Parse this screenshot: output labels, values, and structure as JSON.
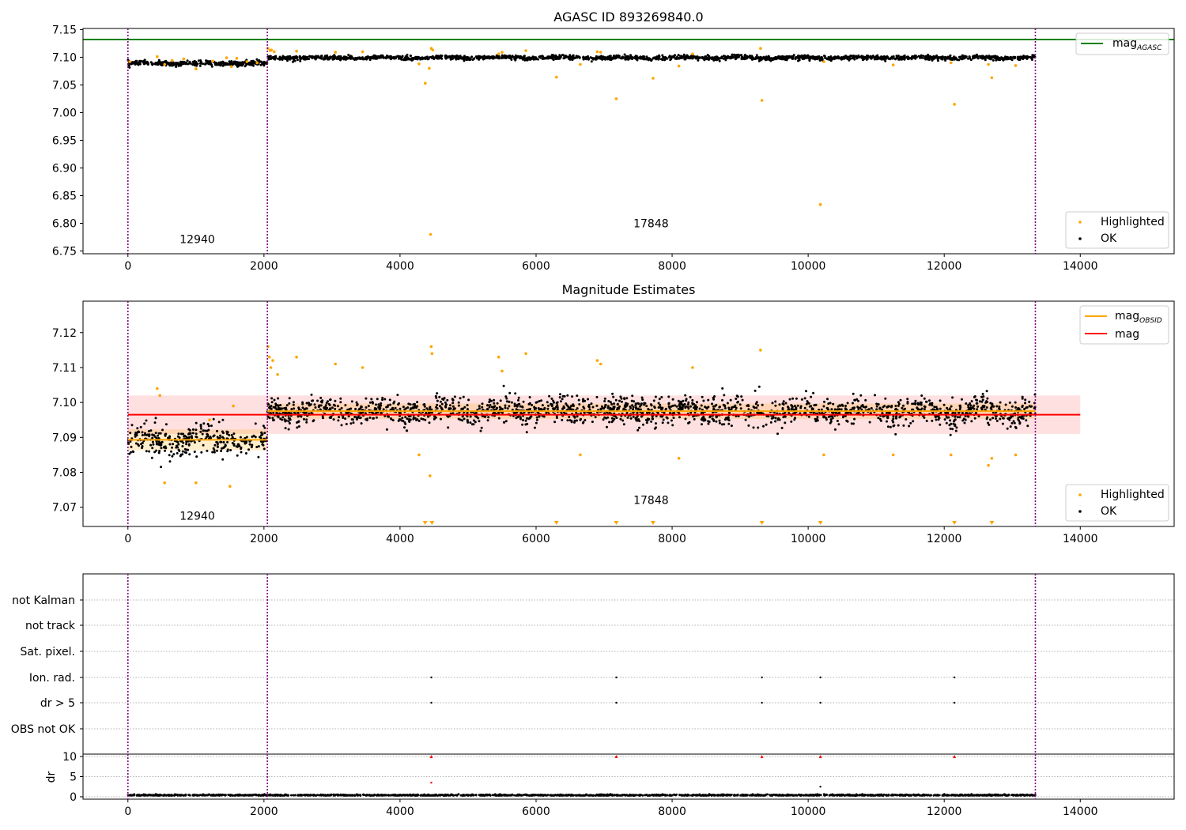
{
  "chart_data": [
    {
      "type": "scatter",
      "title": "AGASC ID 893269840.0",
      "xlim": [
        -660,
        15380
      ],
      "ylim": [
        6.745,
        7.152
      ],
      "yticks": [
        "6.75",
        "6.80",
        "6.85",
        "6.90",
        "6.95",
        "7.00",
        "7.05",
        "7.10",
        "7.15"
      ],
      "xticks": [
        "0",
        "2000",
        "4000",
        "6000",
        "8000",
        "10000",
        "12000",
        "14000"
      ],
      "obsid_labels": [
        {
          "text": "12940",
          "x": 1020,
          "y": 6.764
        },
        {
          "text": "17848",
          "x": 7690,
          "y": 6.793
        }
      ],
      "obsid_boundaries": [
        0,
        2050,
        13340
      ],
      "reference_lines": [
        {
          "name": "mag_AGASC",
          "y": 7.132,
          "color": "#008000"
        }
      ],
      "segments": [
        {
          "x0": 0,
          "x1": 2050,
          "mean": 7.089,
          "spread": 0.004
        },
        {
          "x0": 2050,
          "x1": 13340,
          "mean": 7.099,
          "spread": 0.0035
        }
      ],
      "highlighted": [
        [
          30,
          7.092
        ],
        [
          430,
          7.101
        ],
        [
          540,
          7.087
        ],
        [
          650,
          7.094
        ],
        [
          820,
          7.097
        ],
        [
          1000,
          7.079
        ],
        [
          1250,
          7.093
        ],
        [
          1450,
          7.099
        ],
        [
          1520,
          7.083
        ],
        [
          1600,
          7.098
        ],
        [
          1750,
          7.092
        ],
        [
          1900,
          7.09
        ],
        [
          2060,
          7.116
        ],
        [
          2090,
          7.112
        ],
        [
          2110,
          7.113
        ],
        [
          2150,
          7.11
        ],
        [
          2480,
          7.111
        ],
        [
          3050,
          7.109
        ],
        [
          3450,
          7.11
        ],
        [
          4280,
          7.088
        ],
        [
          4370,
          7.053
        ],
        [
          4430,
          7.08
        ],
        [
          4450,
          6.78
        ],
        [
          4460,
          7.116
        ],
        [
          4480,
          7.113
        ],
        [
          5450,
          7.106
        ],
        [
          5500,
          7.109
        ],
        [
          5850,
          7.112
        ],
        [
          6300,
          7.064
        ],
        [
          6650,
          7.087
        ],
        [
          6900,
          7.11
        ],
        [
          6950,
          7.109
        ],
        [
          7180,
          7.025
        ],
        [
          7720,
          7.062
        ],
        [
          8100,
          7.084
        ],
        [
          8300,
          7.106
        ],
        [
          9300,
          7.116
        ],
        [
          9320,
          7.022
        ],
        [
          10180,
          6.834
        ],
        [
          10230,
          7.092
        ],
        [
          11250,
          7.086
        ],
        [
          12100,
          7.09
        ],
        [
          12150,
          7.015
        ],
        [
          12650,
          7.087
        ],
        [
          12700,
          7.063
        ],
        [
          13050,
          7.085
        ]
      ],
      "legend": [
        {
          "label": "mag_AGASC",
          "position": "top-right"
        },
        {
          "label": "Highlighted"
        },
        {
          "label": "OK"
        }
      ],
      "legend_main": "mag",
      "legend_sub": "AGASC",
      "legend_points": [
        "Highlighted",
        "OK"
      ]
    },
    {
      "type": "scatter",
      "title": "Magnitude Estimates",
      "xlim": [
        -660,
        15380
      ],
      "ylim": [
        7.0645,
        7.129
      ],
      "yticks": [
        "7.07",
        "7.08",
        "7.09",
        "7.10",
        "7.11",
        "7.12"
      ],
      "xticks": [
        "0",
        "2000",
        "4000",
        "6000",
        "8000",
        "10000",
        "12000",
        "14000"
      ],
      "obsid_labels": [
        {
          "text": "12940",
          "x": 1020,
          "y": 7.0664
        },
        {
          "text": "17848",
          "x": 7690,
          "y": 7.071
        }
      ],
      "obsid_boundaries": [
        0,
        2050,
        13340
      ],
      "segments": [
        {
          "x0": 0,
          "x1": 2050,
          "mean": 7.0893,
          "spread": 0.004
        },
        {
          "x0": 2050,
          "x1": 13340,
          "mean": 7.0975,
          "spread": 0.0035
        }
      ],
      "mag_obsid": [
        {
          "x0": 0,
          "x1": 2050,
          "y": 7.0893,
          "lo": 7.0863,
          "hi": 7.0923
        },
        {
          "x0": 2050,
          "x1": 13340,
          "y": 7.0975,
          "lo": 7.0953,
          "hi": 7.0997
        }
      ],
      "mag": {
        "x0": 0,
        "x1": 14000,
        "y": 7.0965,
        "lo": 7.091,
        "hi": 7.102
      },
      "highlighted": [
        [
          430,
          7.104
        ],
        [
          470,
          7.102
        ],
        [
          540,
          7.077
        ],
        [
          1000,
          7.077
        ],
        [
          1200,
          7.095
        ],
        [
          1500,
          7.076
        ],
        [
          1550,
          7.099
        ],
        [
          2060,
          7.116
        ],
        [
          2080,
          7.113
        ],
        [
          2100,
          7.11
        ],
        [
          2130,
          7.112
        ],
        [
          2200,
          7.108
        ],
        [
          2480,
          7.113
        ],
        [
          3050,
          7.111
        ],
        [
          3450,
          7.11
        ],
        [
          4280,
          7.085
        ],
        [
          4440,
          7.079
        ],
        [
          4460,
          7.116
        ],
        [
          4470,
          7.114
        ],
        [
          5450,
          7.113
        ],
        [
          5500,
          7.109
        ],
        [
          5850,
          7.114
        ],
        [
          6650,
          7.085
        ],
        [
          6900,
          7.112
        ],
        [
          6950,
          7.111
        ],
        [
          8100,
          7.084
        ],
        [
          8300,
          7.11
        ],
        [
          9300,
          7.115
        ],
        [
          10230,
          7.085
        ],
        [
          11250,
          7.085
        ],
        [
          12100,
          7.085
        ],
        [
          12650,
          7.082
        ],
        [
          12700,
          7.084
        ],
        [
          13050,
          7.085
        ]
      ],
      "below_range": [
        4370,
        4470,
        6300,
        7180,
        7720,
        9320,
        10180,
        12150,
        12700
      ],
      "legend_main_obsid": "mag",
      "legend_sub_obsid": "OBSID",
      "legend_mag": "mag",
      "legend_points": [
        "Highlighted",
        "OK"
      ]
    },
    {
      "type": "scatter",
      "title": "",
      "xlim": [
        -660,
        15380
      ],
      "flag_categories": [
        "not Kalman",
        "not track",
        "Sat. pixel.",
        "Ion. rad.",
        "dr > 5",
        "OBS not OK"
      ],
      "flags": {
        "Ion. rad.": [
          4460,
          7180,
          9320,
          10180,
          12150
        ],
        "dr > 5": [
          4460,
          7180,
          9320,
          10180,
          12150
        ]
      },
      "obsid_boundaries": [
        0,
        2050,
        13340
      ]
    },
    {
      "type": "scatter",
      "title": "",
      "ylabel": "dr",
      "xlim": [
        -660,
        15380
      ],
      "ylim": [
        -0.6,
        10.6
      ],
      "yticks": [
        "0",
        "5",
        "10"
      ],
      "xticks": [
        "0",
        "2000",
        "4000",
        "6000",
        "8000",
        "10000",
        "12000",
        "14000"
      ],
      "obsid_boundaries": [
        0,
        2050,
        13340
      ],
      "outliers": [
        [
          4460,
          10.0
        ],
        [
          4460,
          3.5
        ],
        [
          7180,
          10.0
        ],
        [
          9320,
          10.0
        ],
        [
          10180,
          10.0
        ],
        [
          10180,
          2.5
        ],
        [
          12150,
          10.0
        ]
      ],
      "baseline": 0.3
    }
  ]
}
